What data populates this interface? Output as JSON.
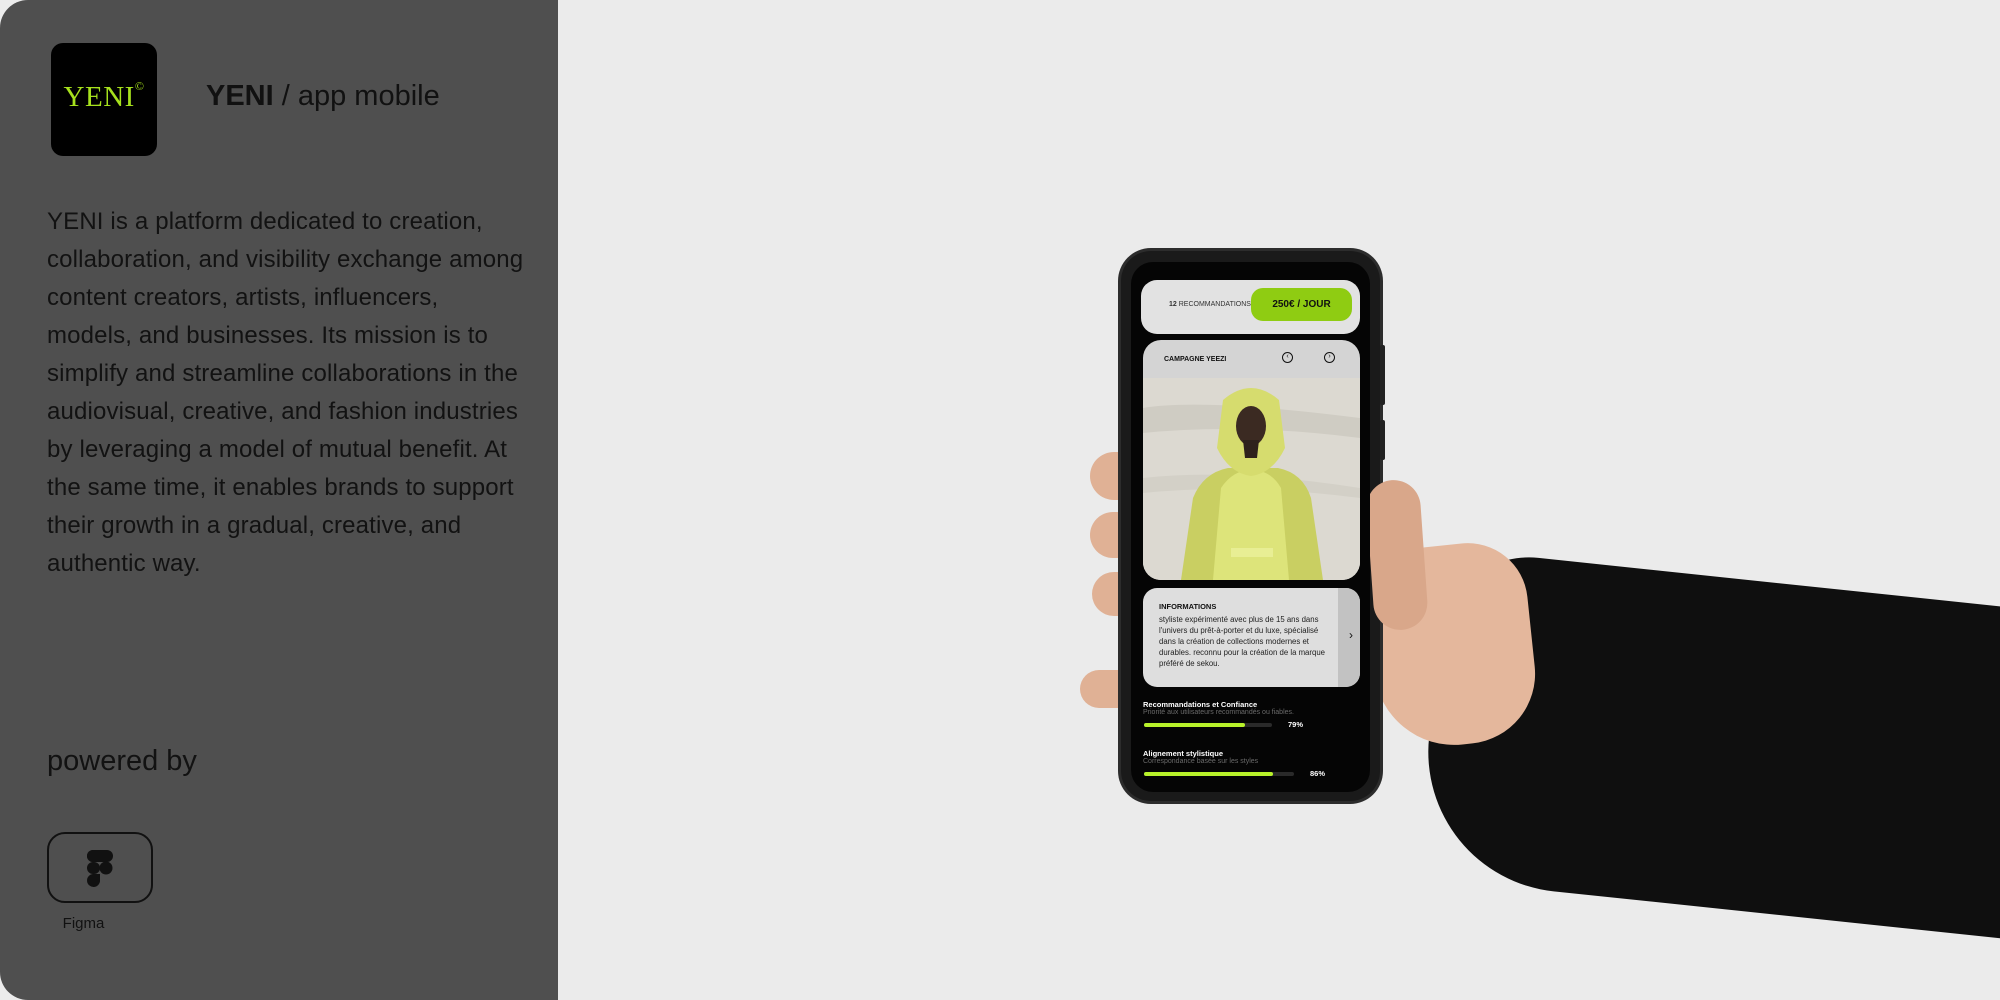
{
  "brand": {
    "logo_text": "YENI",
    "logo_mark": "©",
    "title_bold": "YENI",
    "title_rest": " / app mobile",
    "accent_color": "#a6e11d"
  },
  "description": "YENI is a platform dedicated to creation, collaboration, and visibility exchange among content creators, artists, influencers, models, and businesses. Its mission is to simplify and streamline collaborations in the audiovisual, creative, and fashion industries by leveraging a model of mutual benefit. At the same time, it enables brands to support their growth in a gradual, creative, and authentic way.",
  "powered_by": {
    "label": "powered by",
    "tool_name": "Figma",
    "tool_icon": "figma-icon"
  },
  "phone_app": {
    "recommendations_count": "12",
    "recommendations_label": "RECOMMANDATIONS",
    "price_button": "250€ / JOUR",
    "campaign": {
      "title": "CAMPAGNE YEEZI",
      "prev_icon": "chevron-left-circle-icon",
      "next_icon": "chevron-right-circle-icon"
    },
    "info": {
      "title": "INFORMATIONS",
      "text": "styliste expérimenté avec plus de 15 ans dans l'univers du prêt-à-porter et du luxe, spécialisé dans la création de collections modernes et durables. reconnu pour la création de la marque préféré de sekou."
    },
    "metrics": [
      {
        "title": "Recommandations et Confiance",
        "subtitle": "Priorité aux utilisateurs recommandés ou fiables.",
        "value": 79,
        "label": "79%"
      },
      {
        "title": "Alignement stylistique",
        "subtitle": "Correspondance basée sur les styles",
        "value": 86,
        "label": "86%"
      }
    ],
    "bar_color": "#b8f22a"
  }
}
